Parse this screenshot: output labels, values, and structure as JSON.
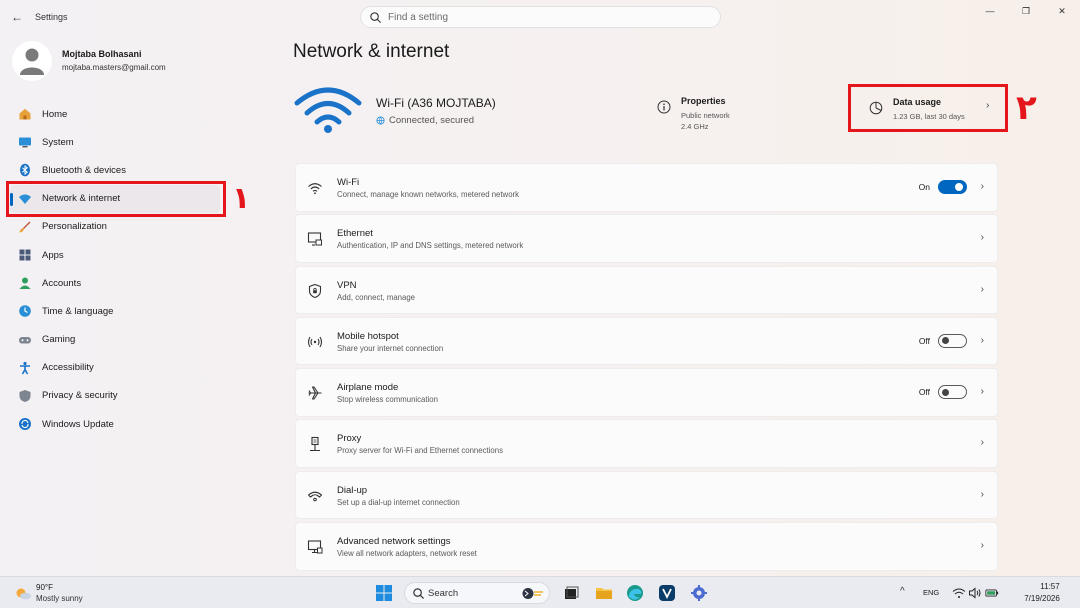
{
  "app": {
    "title": "Settings",
    "back_label": "←"
  },
  "search": {
    "placeholder": "Find a setting"
  },
  "window_controls": [
    "—",
    "❐",
    "✕"
  ],
  "profile": {
    "name": "Mojtaba Bolhasani",
    "email": "mojtaba.masters@gmail.com"
  },
  "sidebar": {
    "items": [
      {
        "label": "Home",
        "icon": "home-icon"
      },
      {
        "label": "System",
        "icon": "monitor-icon"
      },
      {
        "label": "Bluetooth & devices",
        "icon": "bluetooth-icon"
      },
      {
        "label": "Network & internet",
        "icon": "network-icon",
        "selected": true
      },
      {
        "label": "Personalization",
        "icon": "brush-icon"
      },
      {
        "label": "Apps",
        "icon": "apps-icon"
      },
      {
        "label": "Accounts",
        "icon": "account-icon"
      },
      {
        "label": "Time & language",
        "icon": "globe-clock-icon"
      },
      {
        "label": "Gaming",
        "icon": "gamepad-icon"
      },
      {
        "label": "Accessibility",
        "icon": "accessibility-icon"
      },
      {
        "label": "Privacy & security",
        "icon": "shield-icon"
      },
      {
        "label": "Windows Update",
        "icon": "update-icon"
      }
    ]
  },
  "annotations": {
    "marker_1": "١",
    "marker_2": "٢",
    "color": "#e4161b"
  },
  "main": {
    "title": "Network & internet",
    "connection": {
      "ssid": "Wi-Fi (A36 MOJTABA)",
      "status": "Connected, secured"
    },
    "properties": {
      "title": "Properties",
      "line1": "Public network",
      "line2": "2.4 GHz"
    },
    "data_usage": {
      "title": "Data usage",
      "subtitle": "1.23 GB, last 30 days"
    },
    "rows": [
      {
        "title": "Wi-Fi",
        "subtitle": "Connect, manage known networks, metered network",
        "icon": "wifi-icon",
        "state": "On",
        "toggle": "on"
      },
      {
        "title": "Ethernet",
        "subtitle": "Authentication, IP and DNS settings, metered network",
        "icon": "ethernet-icon"
      },
      {
        "title": "VPN",
        "subtitle": "Add, connect, manage",
        "icon": "vpn-shield-icon"
      },
      {
        "title": "Mobile hotspot",
        "subtitle": "Share your internet connection",
        "icon": "hotspot-icon",
        "state": "Off",
        "toggle": "off"
      },
      {
        "title": "Airplane mode",
        "subtitle": "Stop wireless communication",
        "icon": "airplane-icon",
        "state": "Off",
        "toggle": "off"
      },
      {
        "title": "Proxy",
        "subtitle": "Proxy server for Wi-Fi and Ethernet connections",
        "icon": "proxy-icon"
      },
      {
        "title": "Dial-up",
        "subtitle": "Set up a dial-up internet connection",
        "icon": "dialup-icon"
      },
      {
        "title": "Advanced network settings",
        "subtitle": "View all network adapters, network reset",
        "icon": "advanced-network-icon"
      }
    ]
  },
  "taskbar": {
    "weather": {
      "temp": "90°F",
      "desc": "Mostly sunny"
    },
    "search_label": "Search",
    "lang": "ENG",
    "time": "11:57",
    "date": "7/19/2026"
  },
  "colors": {
    "accent": "#0067c0",
    "annotation": "#e4161b"
  }
}
